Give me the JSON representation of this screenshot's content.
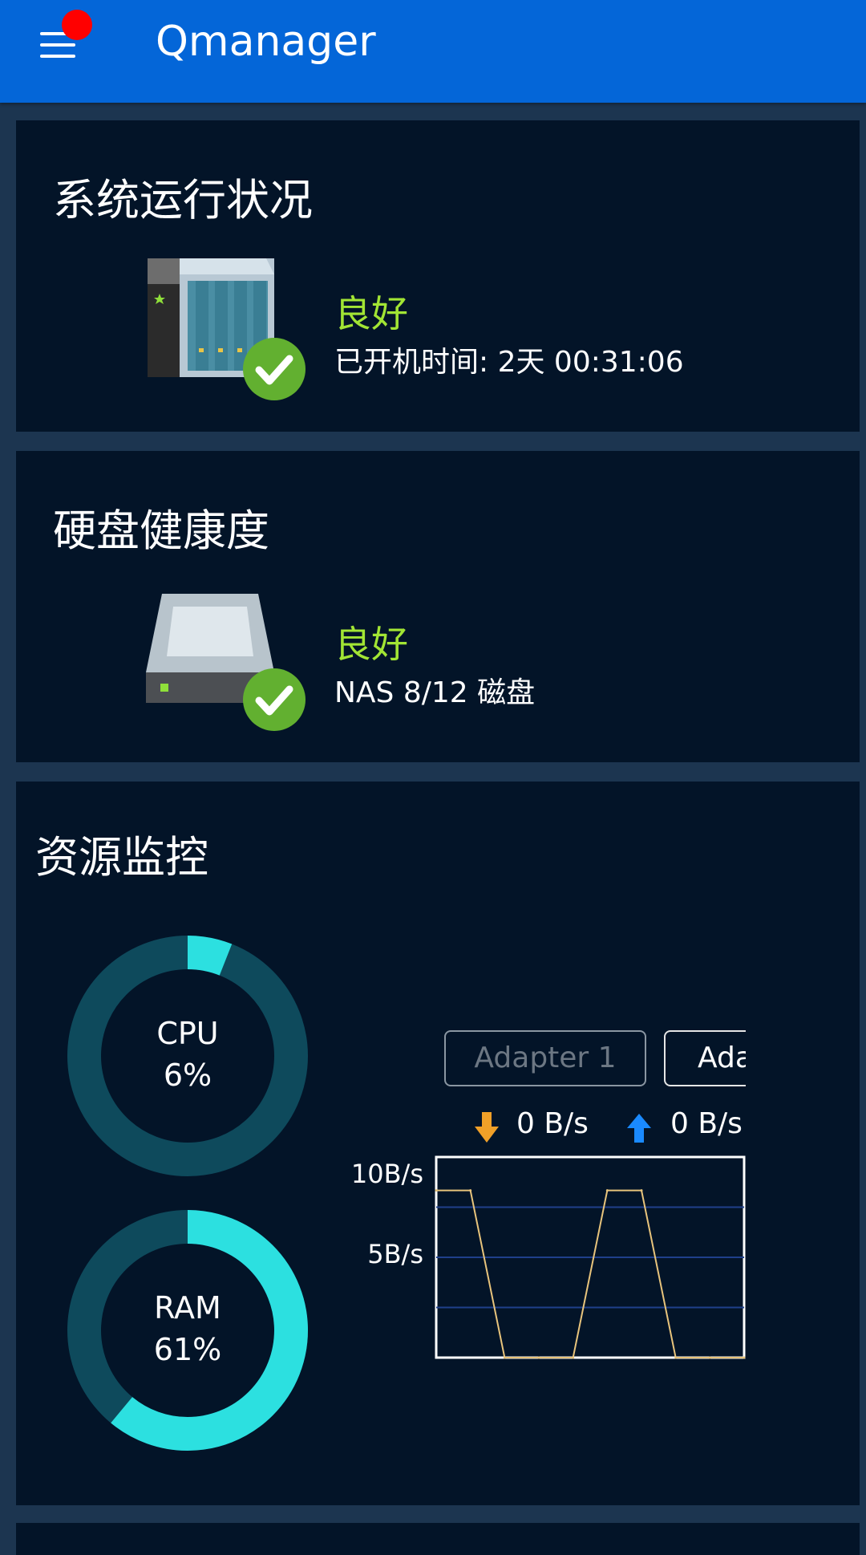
{
  "app": {
    "title": "Qmanager"
  },
  "system_card": {
    "title": "系统运行状况",
    "status": "良好",
    "uptime": "已开机时间: 2天 00:31:06",
    "icon": "nas-device-icon"
  },
  "disk_card": {
    "title": "硬盘健康度",
    "status": "良好",
    "detail": "NAS 8/12 磁盘",
    "icon": "hard-drive-icon"
  },
  "resource_card": {
    "title": "资源监控",
    "cpu": {
      "label": "CPU",
      "value_text": "6%",
      "percent": 6
    },
    "ram": {
      "label": "RAM",
      "value_text": "61%",
      "percent": 61
    },
    "adapters": [
      "Adapter 1",
      "Ada"
    ],
    "download_speed": "0 B/s",
    "upload_speed": "0 B/s"
  },
  "colors": {
    "appbar": "#0466d8",
    "card_bg": "#031428",
    "status_good": "#a2e534",
    "ring_track": "#0e4a5c",
    "ring_fill": "#2ce0e0",
    "line": "#e8c47c"
  },
  "chart_data": {
    "type": "line",
    "title": "",
    "xlabel": "",
    "ylabel": "",
    "y_ticks": [
      "10B/s",
      "5B/s"
    ],
    "ylim": [
      0,
      12
    ],
    "x": [
      0,
      1,
      2,
      3,
      4,
      5,
      6,
      7,
      8,
      9
    ],
    "series": [
      {
        "values": [
          10,
          10,
          0,
          0,
          0,
          10,
          10,
          0,
          0,
          0
        ]
      }
    ]
  }
}
